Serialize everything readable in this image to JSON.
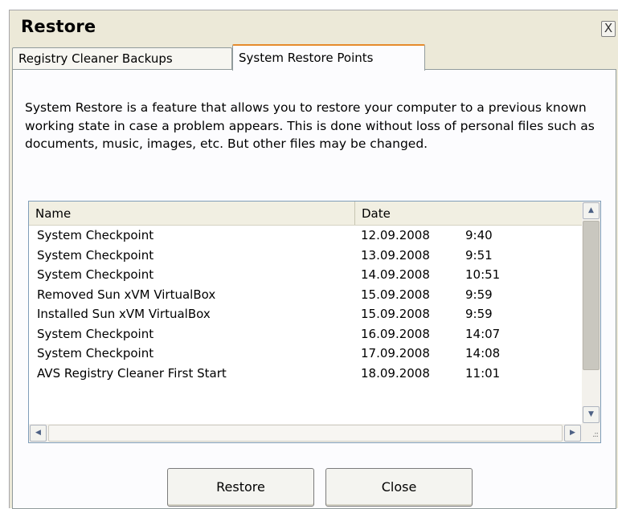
{
  "window": {
    "title": "Restore",
    "close_label": "X"
  },
  "tabs": [
    {
      "label": "Registry Cleaner Backups",
      "selected": false
    },
    {
      "label": "System Restore Points",
      "selected": true
    }
  ],
  "description": "System Restore is a feature that allows you to restore your computer to a previous known working state in case a problem appears. This is done without loss of personal files such as documents, music, images, etc. But other files may be changed.",
  "list": {
    "columns": {
      "name": "Name",
      "date": "Date"
    },
    "rows": [
      {
        "name": "System Checkpoint",
        "date": "12.09.2008",
        "time": "9:40"
      },
      {
        "name": "System Checkpoint",
        "date": "13.09.2008",
        "time": "9:51"
      },
      {
        "name": "System Checkpoint",
        "date": "14.09.2008",
        "time": "10:51"
      },
      {
        "name": "Removed Sun xVM VirtualBox",
        "date": "15.09.2008",
        "time": "9:59"
      },
      {
        "name": "Installed Sun xVM VirtualBox",
        "date": "15.09.2008",
        "time": "9:59"
      },
      {
        "name": "System Checkpoint",
        "date": "16.09.2008",
        "time": "14:07"
      },
      {
        "name": "System Checkpoint",
        "date": "17.09.2008",
        "time": "14:08"
      },
      {
        "name": "AVS Registry Cleaner First Start",
        "date": "18.09.2008",
        "time": "11:01"
      }
    ]
  },
  "buttons": {
    "restore": "Restore",
    "close": "Close"
  },
  "icons": {
    "scroll_up": "up-arrow",
    "scroll_down": "down-arrow",
    "scroll_left": "left-arrow",
    "scroll_right": "right-arrow",
    "close": "close-x"
  },
  "colors": {
    "dialog_bg": "#ece9d8",
    "panel_bg": "#fcfcfe",
    "active_tab_accent": "#e68b2c",
    "list_border": "#7f9db9"
  }
}
